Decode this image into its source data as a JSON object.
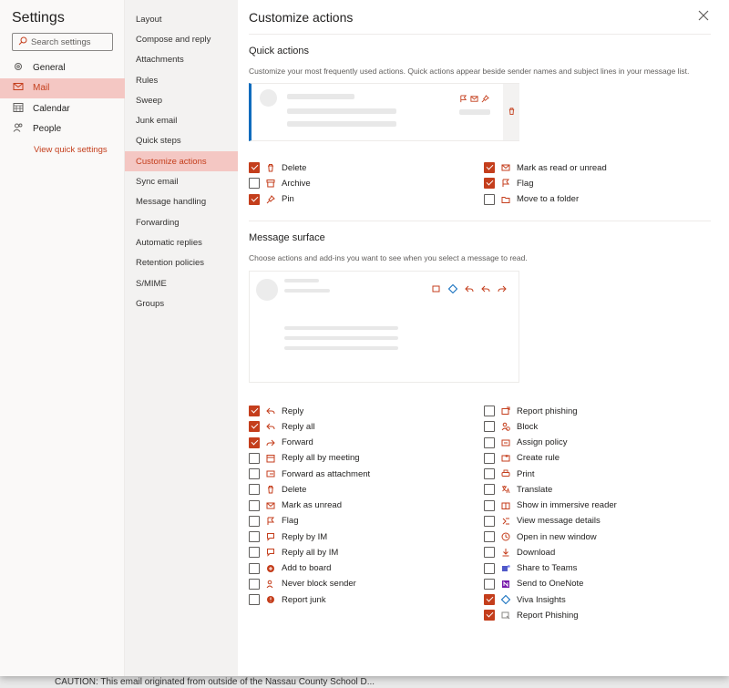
{
  "app": {
    "settings_title": "Settings"
  },
  "search": {
    "placeholder": "Search settings"
  },
  "main_nav": [
    {
      "label": "General",
      "icon": "gear-icon",
      "active": false
    },
    {
      "label": "Mail",
      "icon": "mail-icon",
      "active": true
    },
    {
      "label": "Calendar",
      "icon": "calendar-icon",
      "active": false
    },
    {
      "label": "People",
      "icon": "people-icon",
      "active": false
    }
  ],
  "view_quick_settings": "View quick settings",
  "mail_nav": [
    {
      "label": "Layout",
      "active": false
    },
    {
      "label": "Compose and reply",
      "active": false
    },
    {
      "label": "Attachments",
      "active": false
    },
    {
      "label": "Rules",
      "active": false
    },
    {
      "label": "Sweep",
      "active": false
    },
    {
      "label": "Junk email",
      "active": false
    },
    {
      "label": "Quick steps",
      "active": false
    },
    {
      "label": "Customize actions",
      "active": true
    },
    {
      "label": "Sync email",
      "active": false
    },
    {
      "label": "Message handling",
      "active": false
    },
    {
      "label": "Forwarding",
      "active": false
    },
    {
      "label": "Automatic replies",
      "active": false
    },
    {
      "label": "Retention policies",
      "active": false
    },
    {
      "label": "S/MIME",
      "active": false
    },
    {
      "label": "Groups",
      "active": false
    }
  ],
  "page": {
    "title": "Customize actions"
  },
  "quick_actions": {
    "title": "Quick actions",
    "description": "Customize your most frequently used actions. Quick actions appear beside sender names and subject lines in your message list.",
    "left": [
      {
        "label": "Delete",
        "checked": true,
        "icon": "trash-icon"
      },
      {
        "label": "Archive",
        "checked": false,
        "icon": "archive-icon"
      },
      {
        "label": "Pin",
        "checked": true,
        "icon": "pin-icon"
      }
    ],
    "right": [
      {
        "label": "Mark as read or unread",
        "checked": true,
        "icon": "envelope-icon"
      },
      {
        "label": "Flag",
        "checked": true,
        "icon": "flag-icon"
      },
      {
        "label": "Move to a folder",
        "checked": false,
        "icon": "folder-icon"
      }
    ]
  },
  "message_surface": {
    "title": "Message surface",
    "description": "Choose actions and add-ins you want to see when you select a message to read.",
    "left": [
      {
        "label": "Reply",
        "checked": true,
        "icon": "reply-icon"
      },
      {
        "label": "Reply all",
        "checked": true,
        "icon": "reply-all-icon"
      },
      {
        "label": "Forward",
        "checked": true,
        "icon": "forward-icon"
      },
      {
        "label": "Reply all by meeting",
        "checked": false,
        "icon": "meeting-icon"
      },
      {
        "label": "Forward as attachment",
        "checked": false,
        "icon": "forward-attachment-icon"
      },
      {
        "label": "Delete",
        "checked": false,
        "icon": "trash-icon"
      },
      {
        "label": "Mark as unread",
        "checked": false,
        "icon": "envelope-icon"
      },
      {
        "label": "Flag",
        "checked": false,
        "icon": "flag-icon"
      },
      {
        "label": "Reply by IM",
        "checked": false,
        "icon": "chat-icon"
      },
      {
        "label": "Reply all by IM",
        "checked": false,
        "icon": "chat-all-icon"
      },
      {
        "label": "Add to board",
        "checked": false,
        "icon": "board-icon"
      },
      {
        "label": "Never block sender",
        "checked": false,
        "icon": "safe-sender-icon"
      },
      {
        "label": "Report junk",
        "checked": false,
        "icon": "report-junk-icon"
      }
    ],
    "right": [
      {
        "label": "Report phishing",
        "checked": false,
        "icon": "phishing-icon"
      },
      {
        "label": "Block",
        "checked": false,
        "icon": "block-icon"
      },
      {
        "label": "Assign policy",
        "checked": false,
        "icon": "policy-icon"
      },
      {
        "label": "Create rule",
        "checked": false,
        "icon": "rule-icon"
      },
      {
        "label": "Print",
        "checked": false,
        "icon": "print-icon"
      },
      {
        "label": "Translate",
        "checked": false,
        "icon": "translate-icon"
      },
      {
        "label": "Show in immersive reader",
        "checked": false,
        "icon": "immersive-reader-icon"
      },
      {
        "label": "View message details",
        "checked": false,
        "icon": "details-icon"
      },
      {
        "label": "Open in new window",
        "checked": false,
        "icon": "new-window-icon"
      },
      {
        "label": "Download",
        "checked": false,
        "icon": "download-icon"
      },
      {
        "label": "Share to Teams",
        "checked": false,
        "icon": "teams-icon"
      },
      {
        "label": "Send to OneNote",
        "checked": false,
        "icon": "onenote-icon"
      },
      {
        "label": "Viva Insights",
        "checked": true,
        "icon": "viva-insights-icon"
      },
      {
        "label": "Report Phishing",
        "checked": true,
        "icon": "report-phishing-icon"
      }
    ]
  },
  "caution_banner": "CAUTION: This email originated from outside of the Nassau County School D...",
  "colors": {
    "accent": "#c43e1c",
    "active_bg": "#f4c7c3"
  }
}
